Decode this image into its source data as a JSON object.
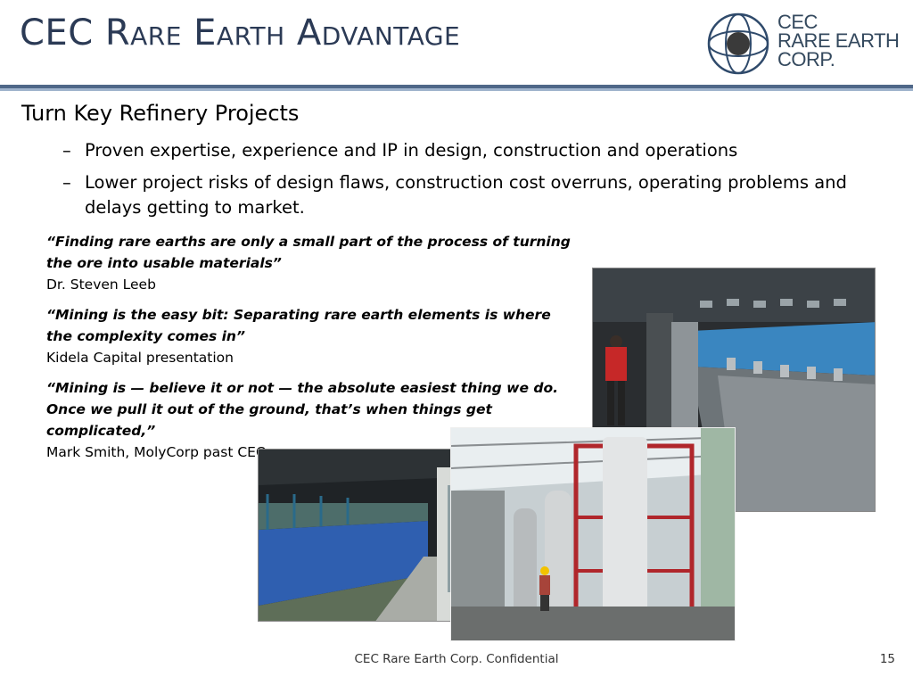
{
  "slide": {
    "title": "CEC Rare Earth Advantage",
    "heading": "Turn Key Refinery Projects",
    "bullets": [
      "Proven expertise, experience and IP in design, construction and operations",
      "Lower project risks of design flaws, construction cost overruns, operating problems and delays getting to market."
    ],
    "bullet_marker": "–",
    "quotes": [
      {
        "text": "“Finding rare earths are only a small part of the process of turning the ore into usable materials”",
        "source": "Dr. Steven Leeb"
      },
      {
        "text": "“Mining is the easy bit: Separating rare earth elements is where the complexity comes in”",
        "source": "Kidela Capital presentation"
      },
      {
        "text": "“Mining is — believe it or not — the absolute easiest thing we do. Once we pull it out of the ground, that’s when things get complicated,”",
        "source": "Mark Smith, MolyCorp past CEO"
      }
    ]
  },
  "logo": {
    "line1": "CEC",
    "line2": "RARE EARTH",
    "line3": "CORP.",
    "ring_color": "#2f4a6b",
    "core_color": "#3a3a3a"
  },
  "footer": {
    "text": "CEC Rare Earth Corp. Confidential",
    "page_number": "15"
  },
  "colors": {
    "title": "#2b3a55",
    "rule_dark": "#4f6788",
    "rule_light": "#9fb3cc",
    "tank_blue": "#2f7fb5"
  },
  "photos": [
    {
      "subject": "refinery-interior-worker-photo"
    },
    {
      "subject": "blue-tank-row-corridor-photo"
    },
    {
      "subject": "extraction-column-scaffold-photo"
    }
  ]
}
